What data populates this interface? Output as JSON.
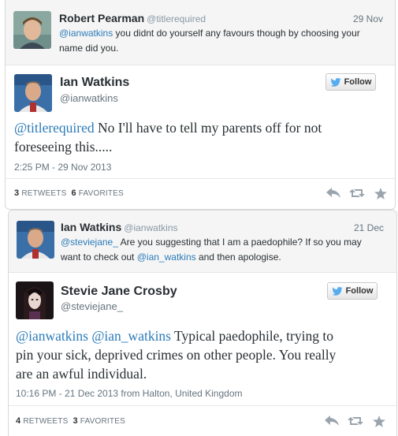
{
  "tweet1": {
    "reply": {
      "name": "Robert Pearman",
      "handle": "@titlerequired",
      "date": "29 Nov",
      "mention": "@ianwatkins",
      "text_line1": " you didnt do yourself any favours though by choosing your",
      "text_line2": "name did you."
    },
    "main": {
      "name": "Ian Watkins",
      "handle": "@ianwatkins",
      "follow_label": "Follow",
      "mention": "@titlerequired",
      "text_line1": " No I'll have to tell my parents off for not",
      "text_line2": "foreseeing this.....",
      "timestamp": "2:25 PM - 29 Nov 2013",
      "retweets_count": "3",
      "retweets_label": "RETWEETS",
      "favorites_count": "6",
      "favorites_label": "FAVORITES"
    }
  },
  "tweet2": {
    "reply": {
      "name": "Ian Watkins",
      "handle": "@ianwatkins",
      "date": "21 Dec",
      "mention": "@steviejane_",
      "text_line1": " Are you suggesting that I am a paedophile? If so you may",
      "text_line2_pre": "want to check out ",
      "mention2": "@ian_watkins",
      "text_line2_post": " and then apologise."
    },
    "main": {
      "name": "Stevie Jane Crosby",
      "handle": "@steviejane_",
      "follow_label": "Follow",
      "mention1": "@ianwatkins",
      "mention2": "@ian_watkins",
      "text_line1": " Typical paedophile, trying to",
      "text_line2": "pin your sick, deprived crimes on other people. You really",
      "text_line3": "are an awful individual.",
      "timestamp": "10:16 PM - 21 Dec 2013 from Halton, United Kingdom",
      "retweets_count": "4",
      "retweets_label": "RETWEETS",
      "favorites_count": "3",
      "favorites_label": "FAVORITES"
    }
  },
  "colors": {
    "link": "#2b7bb9",
    "action_icon": "#9aa4ad",
    "twitter_blue": "#55acee"
  },
  "icons": [
    "bird-icon",
    "reply-icon",
    "retweet-icon",
    "favorite-icon"
  ]
}
